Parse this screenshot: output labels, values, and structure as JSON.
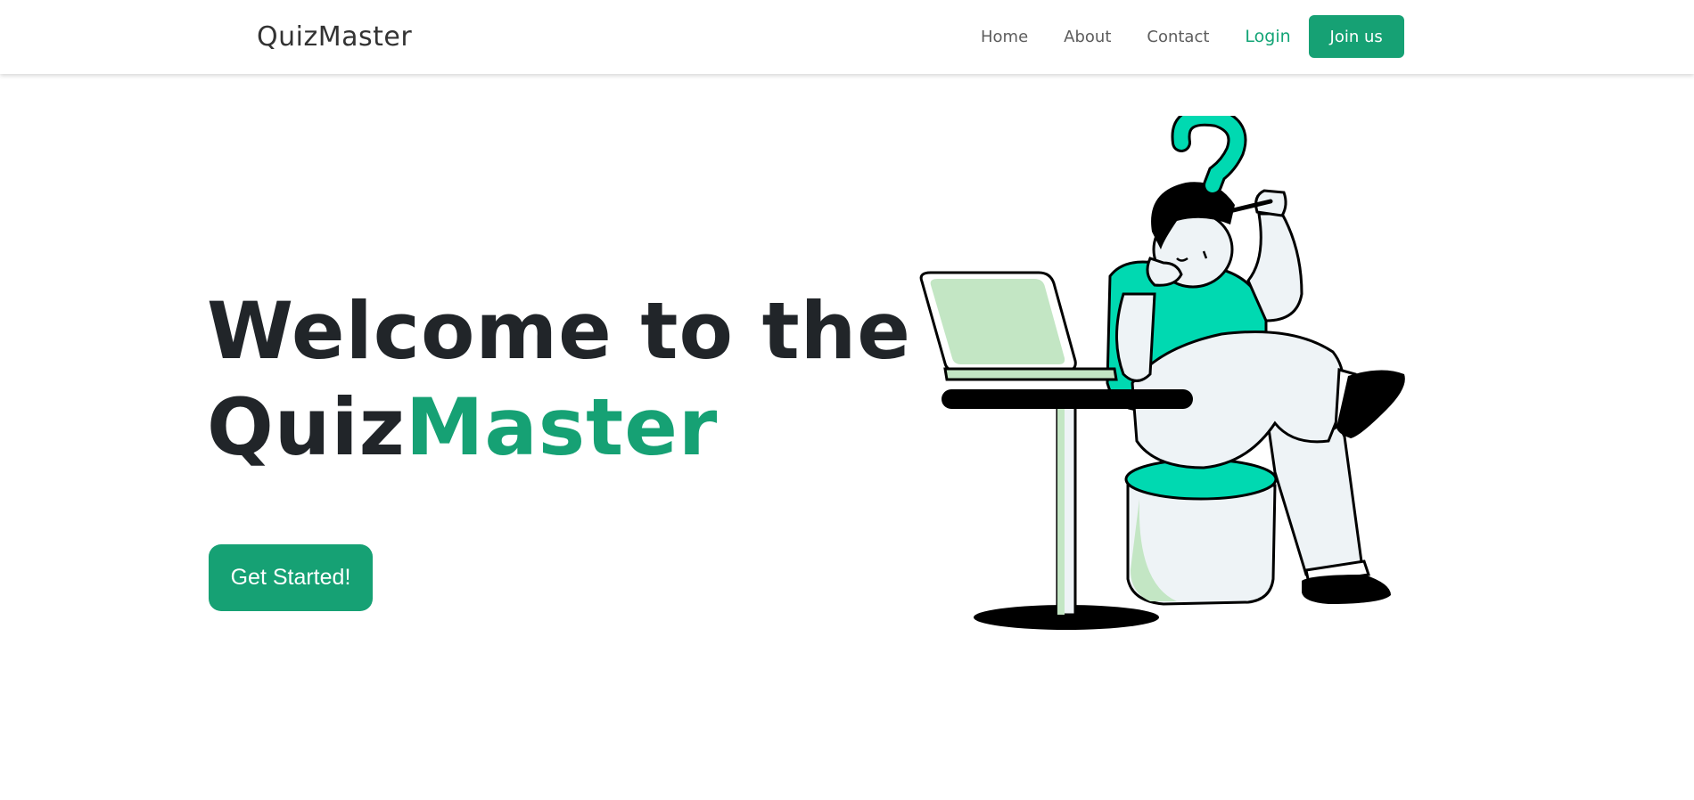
{
  "navbar": {
    "brand": "QuizMaster",
    "links": [
      {
        "label": "Home"
      },
      {
        "label": "About"
      },
      {
        "label": "Contact"
      }
    ],
    "login_label": "Login",
    "join_label": "Join us"
  },
  "hero": {
    "title_line1": "Welcome to the",
    "title_line2_prefix": "Quiz",
    "title_line2_accent": "Master",
    "cta_label": "Get Started!"
  },
  "colors": {
    "accent": "#16a174",
    "illustration_teal": "#00d9b1",
    "illustration_light_green": "#c3e6c4",
    "text_dark": "#212529"
  },
  "icons": {
    "illustration": "person-thinking-at-laptop-illustration"
  }
}
